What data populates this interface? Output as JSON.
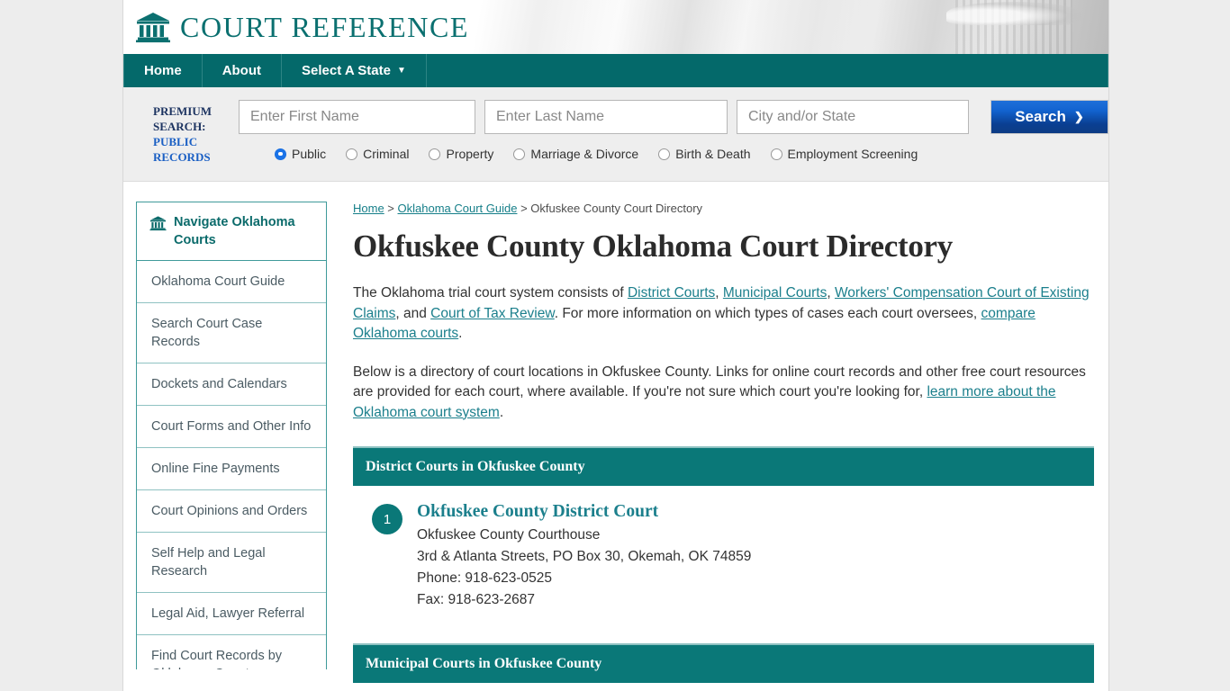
{
  "brand": {
    "title": "COURT REFERENCE",
    "logo_icon": "courthouse-icon"
  },
  "nav": {
    "items": [
      {
        "label": "Home"
      },
      {
        "label": "About"
      },
      {
        "label": "Select A State",
        "caret": "▼"
      }
    ]
  },
  "premium_search": {
    "label_line1": "PREMIUM",
    "label_line2": "SEARCH:",
    "label_line3": "PUBLIC",
    "label_line4": "RECORDS",
    "first_name": {
      "placeholder": "Enter First Name",
      "value": ""
    },
    "last_name": {
      "placeholder": "Enter Last Name",
      "value": ""
    },
    "city_state": {
      "placeholder": "City and/or State",
      "value": ""
    },
    "search_button": {
      "label": "Search",
      "chevron": "❯"
    },
    "radios": [
      {
        "label": "Public",
        "selected": true
      },
      {
        "label": "Criminal",
        "selected": false
      },
      {
        "label": "Property",
        "selected": false
      },
      {
        "label": "Marriage & Divorce",
        "selected": false
      },
      {
        "label": "Birth & Death",
        "selected": false
      },
      {
        "label": "Employment Screening",
        "selected": false
      }
    ]
  },
  "sidebar": {
    "header": {
      "icon": "courthouse-icon",
      "label": "Navigate Oklahoma Courts"
    },
    "items": [
      {
        "label": "Oklahoma Court Guide"
      },
      {
        "label": "Search Court Case Records"
      },
      {
        "label": "Dockets and Calendars"
      },
      {
        "label": "Court Forms and Other Info"
      },
      {
        "label": "Online Fine Payments"
      },
      {
        "label": "Court Opinions and Orders"
      },
      {
        "label": "Self Help and Legal Research"
      },
      {
        "label": "Legal Aid, Lawyer Referral"
      },
      {
        "label": "Find Court Records by Oklahoma County"
      }
    ]
  },
  "breadcrumb": {
    "home": "Home",
    "sep1": " > ",
    "guide": "Oklahoma Court Guide",
    "sep2": " > ",
    "current": "Okfuskee County Court Directory"
  },
  "main": {
    "title": "Okfuskee County Oklahoma Court Directory",
    "para1": {
      "t1": "The Oklahoma trial court system consists of ",
      "l1": "District Courts",
      "t2": ", ",
      "l2": "Municipal Courts",
      "t3": ", ",
      "l3": "Workers' Compensation Court of Existing Claims",
      "t4": ", and ",
      "l4": "Court of Tax Review",
      "t5": ". For more information on which types of cases each court oversees, ",
      "l5": "compare Oklahoma courts",
      "t6": "."
    },
    "para2": {
      "t1": "Below is a directory of court locations in Okfuskee County. Links for online court records and other free court resources are provided for each court, where available. If you're not sure which court you're looking for, ",
      "l1": "learn more about the Oklahoma court system",
      "t2": "."
    },
    "sections": [
      {
        "heading": "District Courts in Okfuskee County",
        "courts": [
          {
            "number": "1",
            "name": "Okfuskee County District Court",
            "line1": "Okfuskee County Courthouse",
            "line2": "3rd & Atlanta Streets, PO Box 30, Okemah, OK 74859",
            "line3": "Phone: 918-623-0525",
            "line4": "Fax: 918-623-2687"
          }
        ]
      },
      {
        "heading": "Municipal Courts in Okfuskee County",
        "courts": []
      }
    ]
  },
  "colors": {
    "teal": "#0a7878",
    "nav_teal": "#04696a",
    "link_teal": "#1b7f8c",
    "brand_teal": "#0b7070",
    "button_blue": "#1263d0",
    "radio_blue": "#1a73e8",
    "page_bg": "#ededed"
  }
}
